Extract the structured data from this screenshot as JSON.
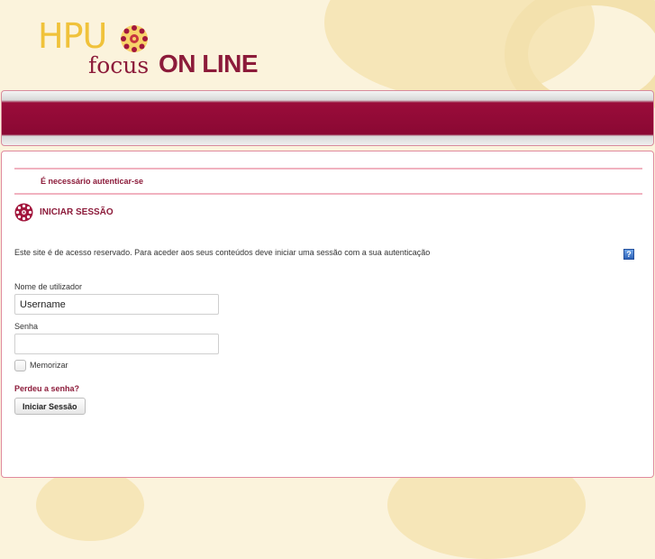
{
  "brand": {
    "logo_hpu": "HPU",
    "logo_focus": "focus",
    "logo_online": "ON LINE",
    "accent_color": "#8c1b3a",
    "gold_color": "#f0c23a"
  },
  "auth": {
    "required_message": "É necessário autenticar-se",
    "section_title": "INICIAR SESSÃO",
    "section_icon": "flower-emblem-icon",
    "intro_text": "Este site é de acesso reservado. Para aceder aos seus conteúdos deve iniciar uma sessão com a sua autenticação",
    "help_icon_glyph": "?"
  },
  "form": {
    "username_label": "Nome de utilizador",
    "username_value": "Username",
    "password_label": "Senha",
    "password_value": "",
    "remember_label": "Memorizar",
    "remember_checked": false,
    "forgot_link": "Perdeu a senha?",
    "submit_label": "Iniciar Sessão"
  }
}
